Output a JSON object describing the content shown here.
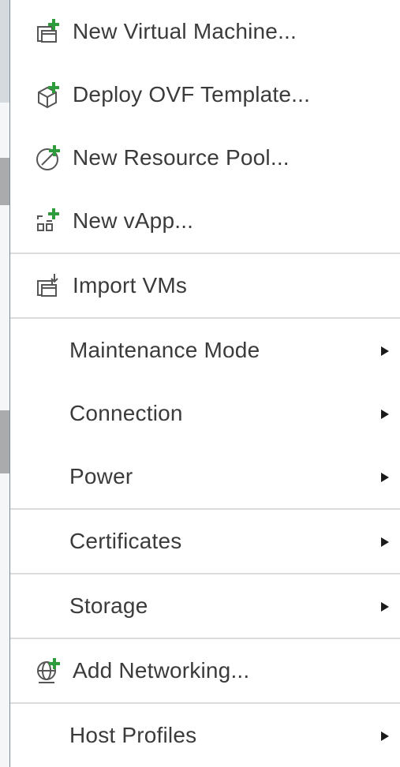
{
  "menu": {
    "items": [
      {
        "label": "New Virtual Machine...",
        "icon": "new-vm-icon"
      },
      {
        "label": "Deploy OVF Template...",
        "icon": "deploy-ovf-icon"
      },
      {
        "label": "New Resource Pool...",
        "icon": "new-resource-pool-icon"
      },
      {
        "label": "New vApp...",
        "icon": "new-vapp-icon"
      },
      {
        "label": "Import VMs",
        "icon": "import-vms-icon"
      },
      {
        "label": "Maintenance Mode",
        "submenu": true
      },
      {
        "label": "Connection",
        "submenu": true
      },
      {
        "label": "Power",
        "submenu": true
      },
      {
        "label": "Certificates",
        "submenu": true
      },
      {
        "label": "Storage",
        "submenu": true
      },
      {
        "label": "Add Networking...",
        "icon": "add-networking-icon"
      },
      {
        "label": "Host Profiles",
        "submenu": true
      }
    ]
  },
  "colors": {
    "text": "#3b3b3b",
    "icon_gray": "#565656",
    "icon_plus_green": "#2e9c3a",
    "divider": "#dcdcdc"
  }
}
